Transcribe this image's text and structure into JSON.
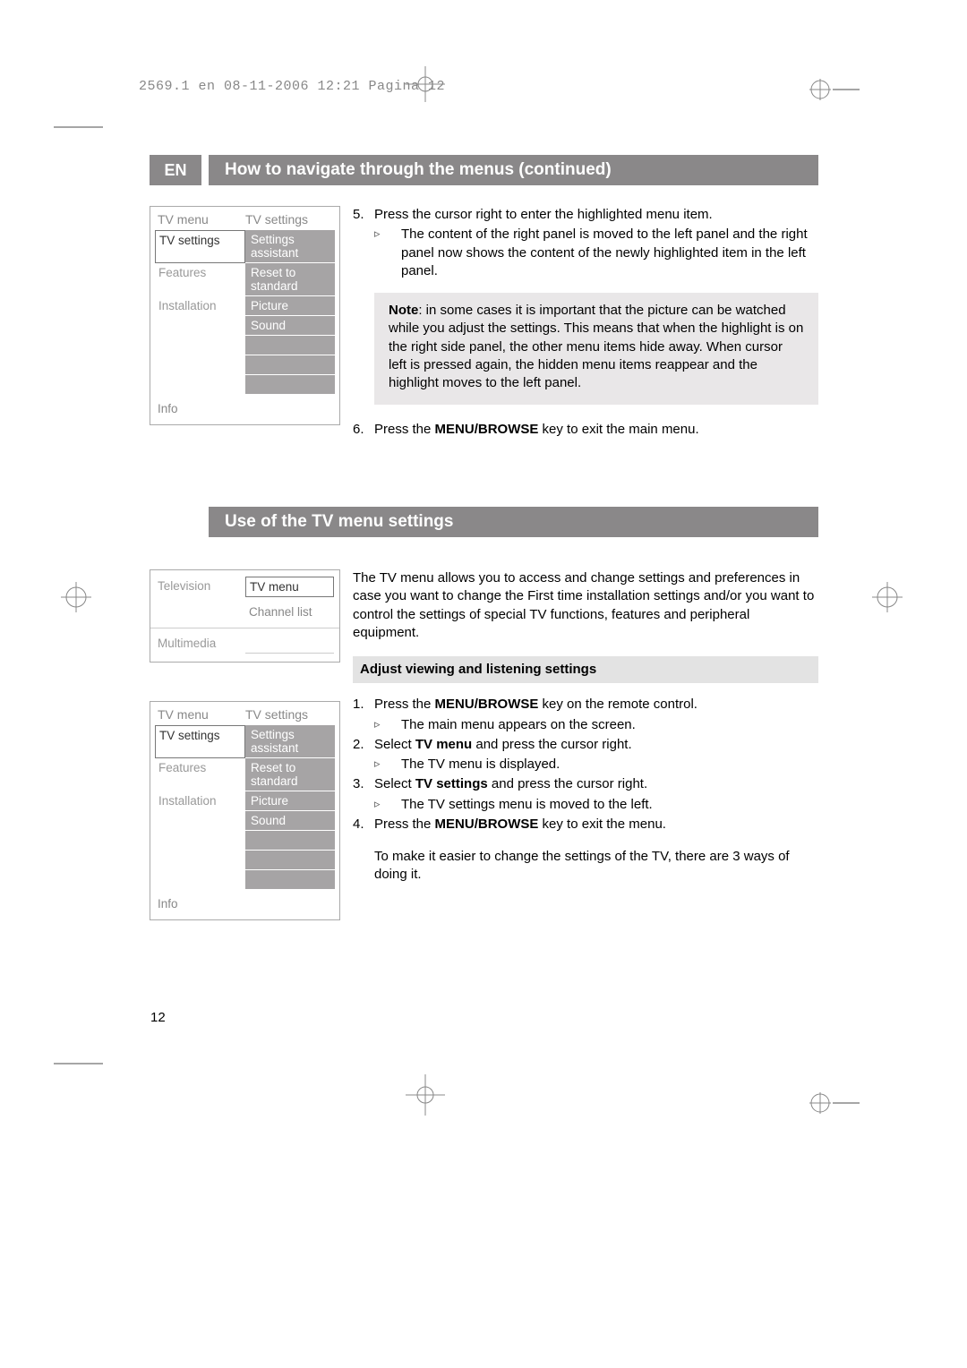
{
  "header_line": "2569.1 en  08-11-2006  12:21  Pagina 12",
  "lang_badge": "EN",
  "section1_title": "How to navigate through the menus  (continued)",
  "section2_title": "Use of the TV menu settings",
  "menu1": {
    "title_left": "TV menu",
    "title_right": "TV settings",
    "left_items": {
      "a": "TV settings",
      "b": "Features",
      "c": "Installation"
    },
    "right_items": {
      "a": "Settings assistant",
      "b": "Reset to standard",
      "c": "Picture",
      "d": "Sound"
    },
    "info": "Info"
  },
  "menu2": {
    "r1l": "Television",
    "r1r": "TV menu",
    "r2r": "Channel list",
    "r3l": "Multimedia"
  },
  "menu3": {
    "title_left": "TV menu",
    "title_right": "TV settings",
    "left_items": {
      "a": "TV settings",
      "b": "Features",
      "c": "Installation"
    },
    "right_items": {
      "a": "Settings assistant",
      "b": "Reset to standard",
      "c": "Picture",
      "d": "Sound"
    },
    "info": "Info"
  },
  "body1": {
    "step5_num": "5.",
    "step5": "Press the cursor right to enter the highlighted menu item.",
    "step5a": "The content of the right panel is moved to the left panel and the right panel now shows the content of the newly highlighted item in the left panel.",
    "note_label": "Note",
    "note_text": ": in some cases it is important that the picture can be watched while you adjust the settings. This means that when the highlight is on the right side panel, the other menu items hide away. When cursor left is pressed again, the hidden menu items reappear and the highlight moves to the left panel.",
    "step6_num": "6.",
    "step6_pre": "Press the ",
    "step6_b": "MENU/BROWSE",
    "step6_post": " key to exit the main menu."
  },
  "body2": {
    "intro": "The TV menu allows you to access and change settings and preferences in case you want to change the First time installation settings and/or you want to control the settings of special TV functions, features and peripheral equipment.",
    "subheading": "Adjust viewing and listening settings",
    "s1_num": "1.",
    "s1_pre": "Press the ",
    "s1_b": "MENU/BROWSE",
    "s1_post": " key on the remote control.",
    "s1a": "The main menu appears on the screen.",
    "s2_num": "2.",
    "s2_pre": "Select ",
    "s2_b": "TV menu",
    "s2_post": " and press the cursor right.",
    "s2a": "The TV menu is displayed.",
    "s3_num": "3.",
    "s3_pre": "Select ",
    "s3_b": "TV settings",
    "s3_post": " and press the cursor right.",
    "s3a": "The TV settings menu is moved to the left.",
    "s4_num": "4.",
    "s4_pre": "Press the ",
    "s4_b": "MENU/BROWSE",
    "s4_post": " key to exit  the menu.",
    "closing": "To make it easier to change the settings of the TV, there are 3 ways of doing it."
  },
  "page_number": "12"
}
